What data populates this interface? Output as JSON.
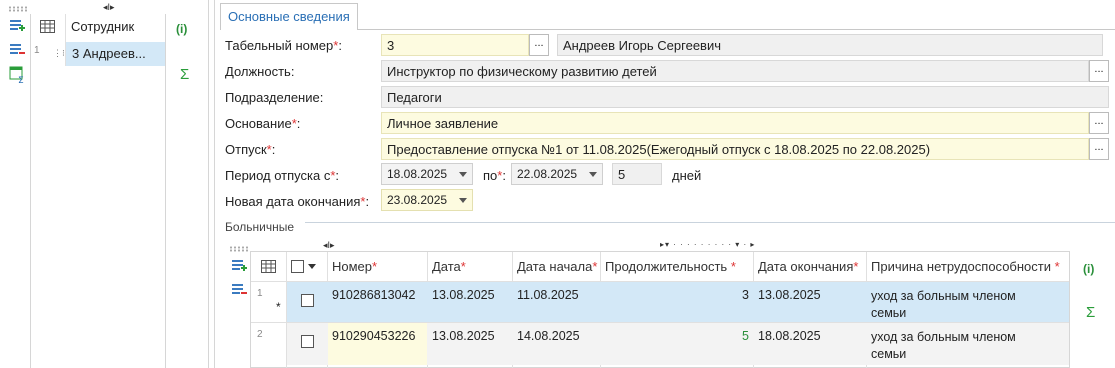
{
  "left_panel": {
    "header": "Сотрудник",
    "row": {
      "num": "1",
      "text": "3  Андреев..."
    }
  },
  "tab": "Основные сведения",
  "form": {
    "tabel_label": "Табельный номер",
    "tabel_value": "3",
    "fio_value": "Андреев Игорь Сергеевич",
    "dolzh_label": "Должность:",
    "dolzh_value": "Инструктор по физическому развитию детей",
    "podr_label": "Подразделение:",
    "podr_value": "Педагоги",
    "osn_label": "Основание",
    "osn_value": "Личное заявление",
    "otpusk_label": "Отпуск",
    "otpusk_value": "Предоставление отпуска №1 от 11.08.2025(Ежегодный отпуск с 18.08.2025 по 22.08.2025)",
    "period_label": "Период отпуска с",
    "period_from": "18.08.2025",
    "po_label": "по",
    "period_to": "22.08.2025",
    "days_value": "5",
    "days_label": "дней",
    "new_end_label": "Новая дата окончания",
    "new_end_value": "23.08.2025",
    "colon": ":",
    "req_mark": "*",
    "ellipsis": "..."
  },
  "sick": {
    "section_label": "Больничные",
    "columns": [
      "Номер",
      "Дата",
      "Дата начала",
      "Продолжительность",
      "Дата окончания",
      "Причина нетрудоспособности"
    ],
    "rows": [
      {
        "idx": "1",
        "marker": "*",
        "number": "910286813042",
        "date": "13.08.2025",
        "start": "11.08.2025",
        "duration": "3",
        "end": "13.08.2025",
        "reason1": "уход за больным членом",
        "reason2": "семьи"
      },
      {
        "idx": "2",
        "marker": "",
        "number": "910290453226",
        "date": "13.08.2025",
        "start": "14.08.2025",
        "duration": "5",
        "end": "18.08.2025",
        "reason1": "уход за больным членом",
        "reason2": "семьи"
      }
    ]
  },
  "icons": {
    "info": "(i)",
    "sum": "Σ"
  },
  "colors": {
    "accent": "#2a6fb5",
    "selected_row": "#d3e8f7",
    "required": "#d33",
    "highlight": "#fdfbe0"
  }
}
